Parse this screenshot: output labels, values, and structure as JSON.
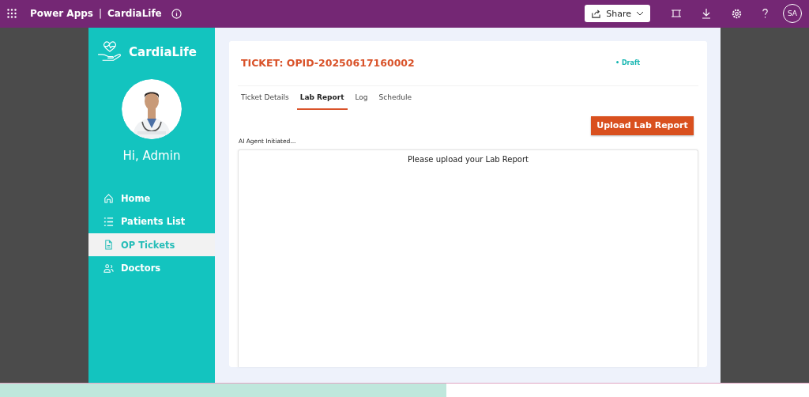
{
  "topbar": {
    "app": "Power Apps",
    "separator": "|",
    "title": "CardiaLife",
    "share": "Share",
    "avatar": "SA"
  },
  "sidebar": {
    "brand": "CardiaLife",
    "greeting": "Hi, Admin",
    "items": [
      {
        "label": "Home",
        "kind": "home",
        "selected": false
      },
      {
        "label": "Patients List",
        "kind": "list",
        "selected": false
      },
      {
        "label": "OP Tickets",
        "kind": "document",
        "selected": true
      },
      {
        "label": "Doctors",
        "kind": "people",
        "selected": false
      }
    ]
  },
  "ticket": {
    "title": "TICKET: OPID-20250617160002",
    "status": "• Draft",
    "tabs": [
      {
        "label": "Ticket Details",
        "selected": false
      },
      {
        "label": "Lab Report",
        "selected": true
      },
      {
        "label": "Log",
        "selected": false
      },
      {
        "label": "Schedule",
        "selected": false
      }
    ],
    "upload_button": "Upload Lab Report",
    "agent_status": "AI Agent Initiated...",
    "upload_prompt": "Please upload your Lab Report"
  }
}
